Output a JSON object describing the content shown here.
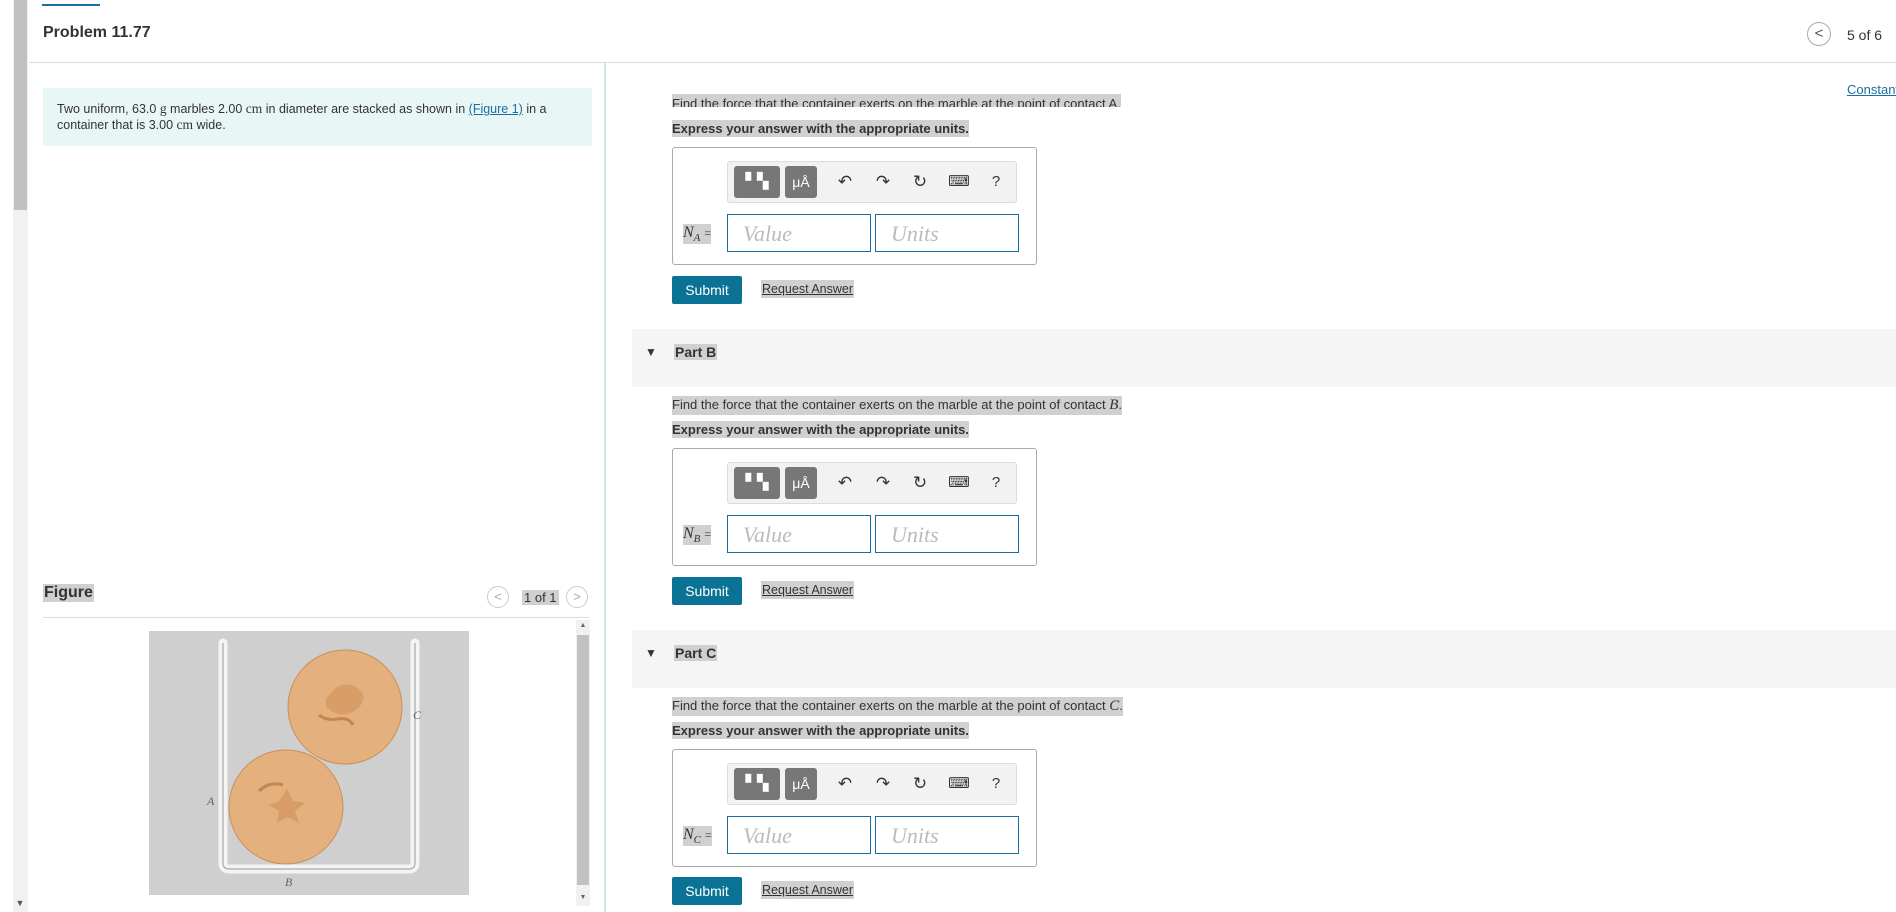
{
  "header": {
    "title": "Problem 11.77",
    "page_count": "5 of 6",
    "prev_icon": "<",
    "constants_link": "Constants"
  },
  "problem": {
    "text_before": "Two uniform, 63.0 ",
    "unit_g": "g",
    "text_mid1": " marbles 2.00 ",
    "unit_cm1": "cm",
    "text_mid2": " in diameter are stacked as shown in ",
    "figure_link": "(Figure 1)",
    "text_mid3": " in a container that is 3.00 ",
    "unit_cm2": "cm",
    "text_after": " wide."
  },
  "figure": {
    "title": "Figure",
    "count": "1 of 1",
    "label_a": "A",
    "label_b": "B",
    "label_c": "C"
  },
  "part_a": {
    "cut_prompt": "Find the force that the container exerts on the marble at the point of contact A.",
    "instruction": "Express your answer with the appropriate units.",
    "var": "N",
    "var_sub": "A",
    "equals": "=",
    "value_placeholder": "Value",
    "units_placeholder": "Units",
    "submit": "Submit",
    "request": "Request Answer"
  },
  "part_b": {
    "title": "Part B",
    "prompt_text": "Find the force that the container exerts on the marble at the point of contact ",
    "prompt_point": "B",
    "prompt_end": ".",
    "instruction": "Express your answer with the appropriate units.",
    "var": "N",
    "var_sub": "B",
    "equals": "=",
    "value_placeholder": "Value",
    "units_placeholder": "Units",
    "submit": "Submit",
    "request": "Request Answer"
  },
  "part_c": {
    "title": "Part C",
    "prompt_text": "Find the force that the container exerts on the marble at the point of contact ",
    "prompt_point": "C",
    "prompt_end": ".",
    "instruction": "Express your answer with the appropriate units.",
    "var": "N",
    "var_sub": "C",
    "equals": "=",
    "value_placeholder": "Value",
    "units_placeholder": "Units",
    "submit": "Submit",
    "request": "Request Answer"
  },
  "toolbar": {
    "units_button": "μÅ",
    "help": "?",
    "icons": [
      "templates-icon",
      "units-icon",
      "undo-icon",
      "redo-icon",
      "reset-icon",
      "keyboard-icon",
      "help-icon"
    ]
  },
  "colors": {
    "accent": "#0a7294",
    "link": "#1a6fa0",
    "problem_bg": "#e8f6f6",
    "marble": "#e3b07e"
  }
}
